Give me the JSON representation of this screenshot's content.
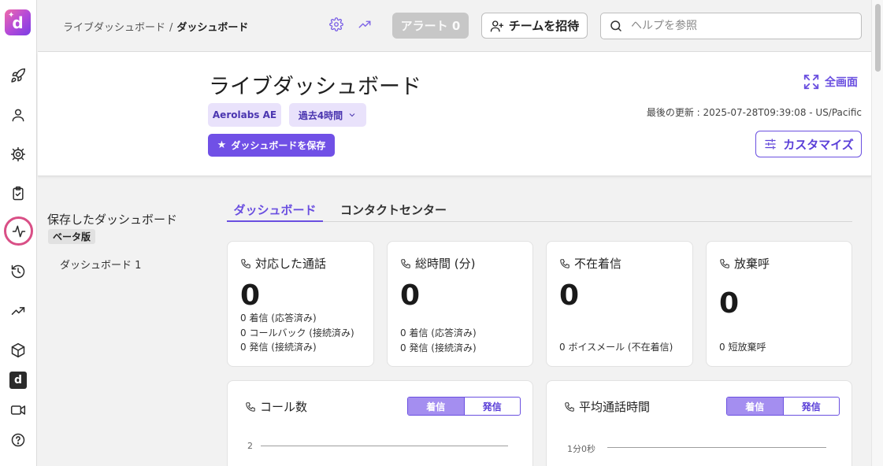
{
  "breadcrumb": {
    "parent": "ライブダッシュボード",
    "sep": "/",
    "current": "ダッシュボード"
  },
  "topbar": {
    "alert_label": "アラート 0",
    "invite_label": "チームを招待",
    "search_placeholder": "ヘルプを参照"
  },
  "header": {
    "title": "ライブダッシュボード",
    "account_chip": "Aerolabs AE",
    "range_chip": "過去4時間",
    "save_label": "ダッシュボードを保存",
    "fullscreen_label": "全画面",
    "last_updated": "最後の更新 : 2025-07-28T09:39:08 - US/Pacific",
    "customize_label": "カスタマイズ"
  },
  "saved": {
    "title": "保存したダッシュボード",
    "badge": "ベータ版",
    "items": [
      "ダッシュボード 1"
    ]
  },
  "tabs": [
    "ダッシュボード",
    "コンタクトセンター"
  ],
  "stats": [
    {
      "title": "対応した通話",
      "value": "0",
      "lines": [
        "0 着信 (応答済み)",
        "0 コールバック (接続済み)",
        "0 発信 (接続済み)"
      ]
    },
    {
      "title": "総時間 (分)",
      "value": "0",
      "lines": [
        "0 着信 (応答済み)",
        "0 発信 (接続済み)"
      ]
    },
    {
      "title": "不在着信",
      "value": "0",
      "lines": [
        "0 ボイスメール (不在着信)"
      ]
    },
    {
      "title": "放棄呼",
      "value": "0",
      "lines": [
        "0 短放棄呼"
      ]
    }
  ],
  "charts": [
    {
      "title": "コール数",
      "toggle": [
        "着信",
        "発信"
      ],
      "tick": "2"
    },
    {
      "title": "平均通話時間",
      "toggle": [
        "着信",
        "発信"
      ],
      "tick": "1分0秒"
    }
  ],
  "icons": {
    "rail": [
      "rocket-icon",
      "user-icon",
      "gear-icon",
      "clipboard-icon",
      "activity-icon",
      "history-icon",
      "trending-icon",
      "box-icon",
      "d-app-icon",
      "video-icon",
      "help-icon"
    ]
  },
  "colors": {
    "accent": "#6a4fe0",
    "active_ring": "#d94f86",
    "chip_bg": "#e9e2fb"
  }
}
